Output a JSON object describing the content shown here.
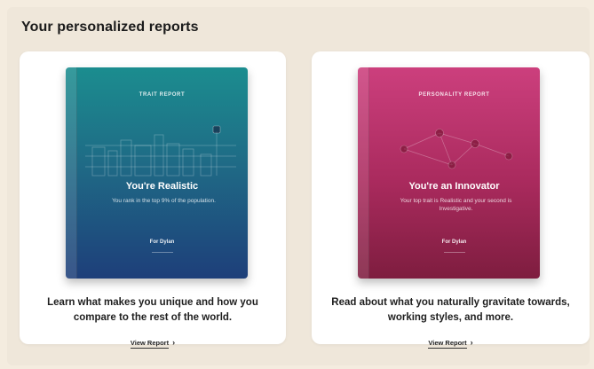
{
  "section": {
    "title": "Your personalized reports"
  },
  "reports": [
    {
      "kicker": "TRAIT REPORT",
      "title": "You're Realistic",
      "subtitle": "You rank in the top 9% of the population.",
      "for": "For Dylan",
      "description": "Learn what makes you unique and how you compare to the rest of the world.",
      "link_label": "View Report",
      "link_icon": "chevron-right-icon",
      "cover_colors": [
        "#1b8d8f",
        "#1e3f7a"
      ]
    },
    {
      "kicker": "PERSONALITY REPORT",
      "title": "You're an Innovator",
      "subtitle": "Your top trait is Realistic and your second is Investigative.",
      "for": "For Dylan",
      "description": "Read about what you naturally gravitate towards, working styles, and more.",
      "link_label": "View Report",
      "link_icon": "chevron-right-icon",
      "cover_colors": [
        "#cc3f7d",
        "#7e1d3f"
      ]
    }
  ]
}
